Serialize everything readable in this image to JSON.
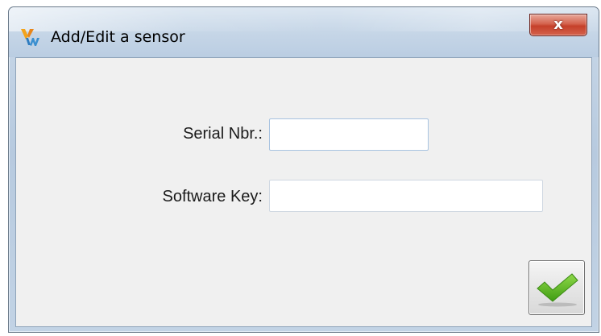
{
  "window": {
    "title": "Add/Edit a sensor",
    "close_label": "x",
    "app_icon": "yw-logo-icon"
  },
  "form": {
    "serial_label": "Serial Nbr.:",
    "serial_value": "",
    "key_label": "Software Key:",
    "key_value": ""
  },
  "actions": {
    "ok_icon": "checkmark-icon"
  },
  "colors": {
    "client_bg": "#f0f0f0",
    "close_red": "#c5402a",
    "check_green": "#5ab71e"
  }
}
